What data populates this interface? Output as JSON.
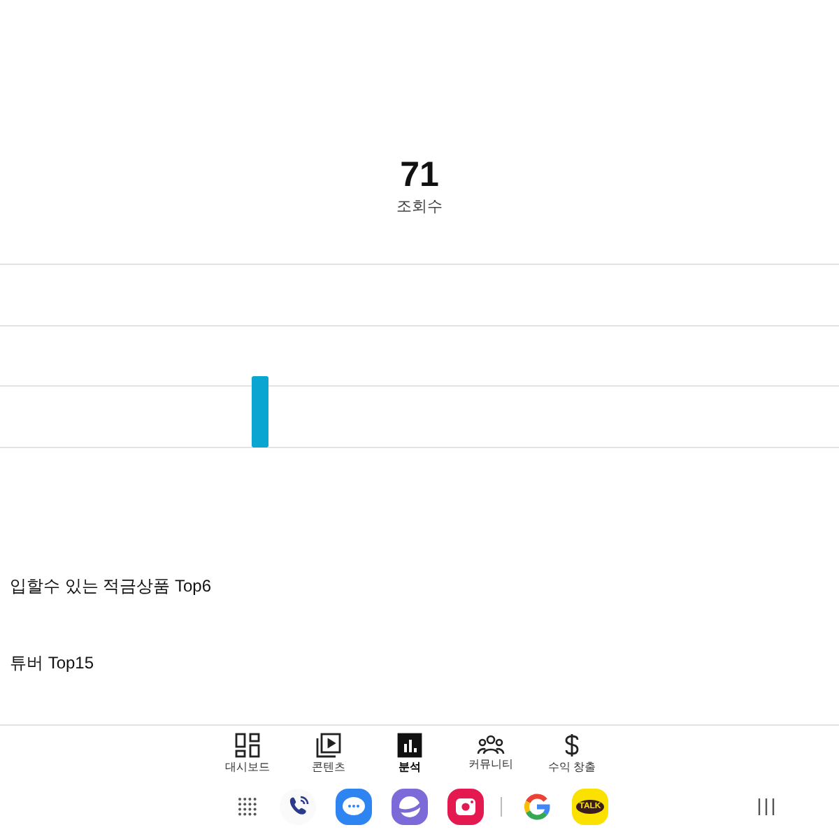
{
  "summary": {
    "value": "71",
    "label": "조회수"
  },
  "list_items": [
    {
      "title": "입할수 있는 적금상품 Top6"
    },
    {
      "title": "튜버 Top15"
    }
  ],
  "nav_tabs": [
    {
      "label": "대시보드",
      "selected": false
    },
    {
      "label": "콘텐츠",
      "selected": false
    },
    {
      "label": "분석",
      "selected": true
    },
    {
      "label": "커뮤니티",
      "selected": false
    },
    {
      "label": "수익 창출",
      "selected": false
    }
  ],
  "dock": {
    "talk_badge": "TALK"
  }
}
